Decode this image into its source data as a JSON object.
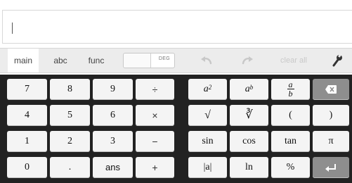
{
  "tabs": [
    {
      "label": "main"
    },
    {
      "label": "abc"
    },
    {
      "label": "func"
    }
  ],
  "angle_toggle": {
    "label": "DEG"
  },
  "clear_label": "clear all",
  "numpad": {
    "row1": [
      "7",
      "8",
      "9",
      "÷"
    ],
    "row2": [
      "4",
      "5",
      "6",
      "×"
    ],
    "row3": [
      "1",
      "2",
      "3",
      "−"
    ],
    "row4": [
      "0",
      ".",
      "ans",
      "+"
    ]
  },
  "funcpad": {
    "a_sq": {
      "base": "a",
      "exp": "2"
    },
    "a_b": {
      "base": "a",
      "exp": "b"
    },
    "frac": {
      "num": "a",
      "den": "b"
    },
    "sqrt": "√",
    "nroot": "∛",
    "open_paren": "(",
    "close_paren": ")",
    "sin": "sin",
    "cos": "cos",
    "tan": "tan",
    "pi": "π",
    "abs": "|a|",
    "ln": "ln",
    "percent": "%"
  },
  "colors": {
    "pad_bg": "#222222",
    "key_bg": "#f4f4f4",
    "special_key_bg": "#8e8e8e",
    "toolbar_bg": "#ececec"
  }
}
